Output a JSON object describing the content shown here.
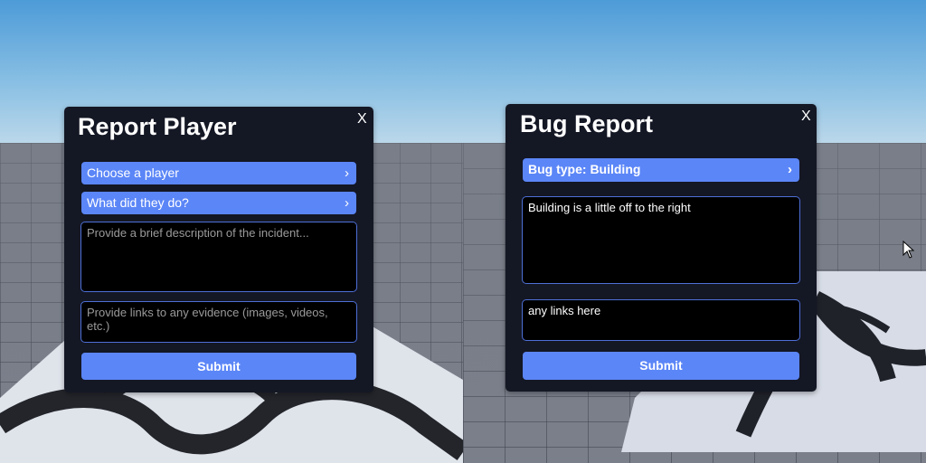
{
  "report_player": {
    "title": "Report Player",
    "close_label": "X",
    "player_dropdown": "Choose a player",
    "reason_dropdown": "What did they do?",
    "description_placeholder": "Provide a brief description of the incident...",
    "evidence_placeholder": "Provide links to any evidence (images, videos, etc.)",
    "submit_label": "Submit"
  },
  "bug_report": {
    "title": "Bug Report",
    "close_label": "X",
    "type_dropdown": "Bug type: Building",
    "description_value": "Building is a little off to the right",
    "links_value": "any links here",
    "submit_label": "Submit"
  },
  "icons": {
    "chevron": "chevron-right-icon",
    "cursor": "mouse-cursor-icon"
  },
  "colors": {
    "panel_bg": "#141724",
    "accent": "#5b86f7",
    "input_border": "#4e6fd6"
  }
}
